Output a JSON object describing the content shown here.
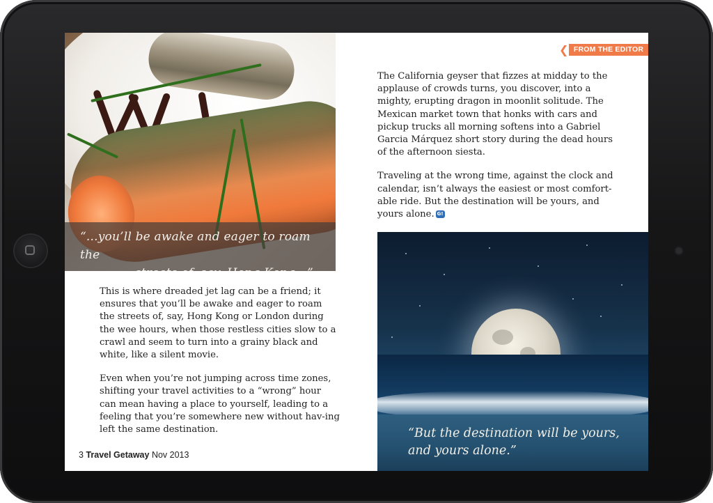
{
  "header": {
    "section_tag": "FROM THE EDITOR"
  },
  "food_photo": {
    "quote_line1": "“...you’ll be awake and eager to roam the",
    "quote_line2": "streets of, say, Hong Kong...”"
  },
  "left_column": {
    "paragraphs": [
      "This is where dreaded jet lag can be a friend;  it ensures that you’ll be awake and eager to roam the streets of, say, Hong Kong or London during the wee hours, when those restless cities slow to a crawl and seem to turn into a grainy black and white, like a silent movie.",
      "Even when you’re not jumping across time zones, shifting your travel activities to a “wrong” hour can mean having a place to yourself, leading to a feeling that you’re somewhere new without hav-ing left the same destination."
    ]
  },
  "right_column": {
    "paragraphs": [
      "The California geyser that fizzes at midday to the applause of crowds turns, you discover, into a mighty, erupting dragon in moonlit solitude. The Mexican market town that honks with cars and pickup trucks all morning softens into a Gabriel Garcia Márquez short story during the dead hours of the afternoon siesta.",
      "Traveling at the wrong time, against the clock and calendar, isn’t always the easiest or most comfort-able ride. But the destination will be yours, and yours alone."
    ],
    "end_badge": "G!"
  },
  "moon_photo": {
    "quote": "“But the destination will be yours, and yours alone.”"
  },
  "footer": {
    "page_number": "3",
    "magazine": "Travel Getaway",
    "issue": "Nov 2013"
  },
  "colors": {
    "accent": "#f07b48",
    "badge": "#2f6fb8"
  },
  "icons": {
    "home_button": "home-button-icon",
    "camera": "camera-icon",
    "section_chevron": "chevron-left-icon"
  }
}
